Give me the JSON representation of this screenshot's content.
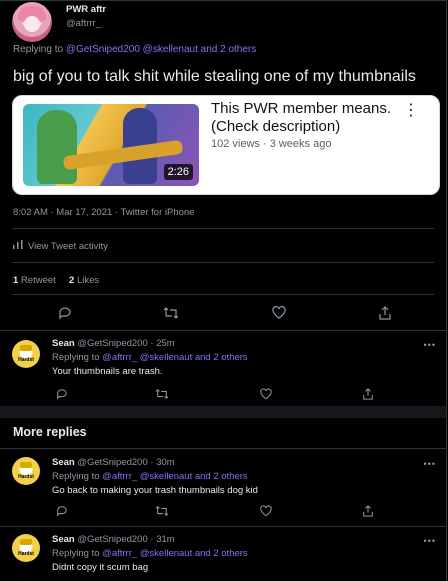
{
  "main_tweet": {
    "author_name": "PWR aftr",
    "author_handle": "@aftrrr_",
    "replying_prefix": "Replying to",
    "replying_handles": "@GetSniped200 @skellenaut and 2 others",
    "text": "big of you to talk shit while stealing one of my thumbnails",
    "card": {
      "title": "This PWR member means. (Check description)",
      "meta": "102 views · 3 weeks ago",
      "duration": "2:26",
      "kebab": "⋮"
    },
    "timestamp": "8:02 AM · Mar 17, 2021 · Twitter for iPhone",
    "activity_label": "View Tweet activity",
    "retweets_count": "1",
    "retweets_label": "Retweet",
    "likes_count": "2",
    "likes_label": "Likes"
  },
  "replies": [
    {
      "name": "Sean",
      "handle_time": "@GetSniped200 · 25m",
      "replying_prefix": "Replying to",
      "replying_handles": "@aftrrr_ @skellenaut and 2 others",
      "text": "Your thumbnails are trash."
    },
    {
      "name": "Sean",
      "handle_time": "@GetSniped200 · 30m",
      "replying_prefix": "Replying to",
      "replying_handles": "@aftrrr_ @skellenaut and 2 others",
      "text": "Go back to making your trash thumbnails dog kid"
    },
    {
      "name": "Sean",
      "handle_time": "@GetSniped200 · 31m",
      "replying_prefix": "Replying to",
      "replying_handles": "@aftrrr_ @skellenaut and 2 others",
      "text": "Didnt copy it scum bag"
    }
  ],
  "avatar_badge_text": "Hardst",
  "more_replies_label": "More replies",
  "icons": {
    "reply": "reply-icon",
    "retweet": "retweet-icon",
    "like": "heart-icon",
    "share": "share-icon",
    "more": "more-icon",
    "activity": "bar-chart-icon"
  },
  "colors": {
    "link": "#8e6cf6",
    "background": "#000000",
    "secondary_text": "#8b98a5"
  }
}
